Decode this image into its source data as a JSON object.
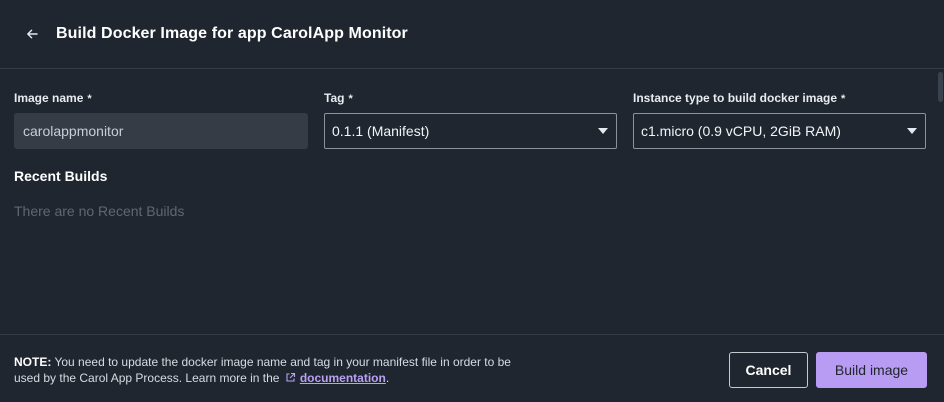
{
  "header": {
    "title": "Build Docker Image for app CarolApp Monitor",
    "back_icon": "arrow-left-icon"
  },
  "form": {
    "image_name": {
      "label": "Image name",
      "required_mark": "*",
      "value": "carolappmonitor"
    },
    "tag": {
      "label": "Tag",
      "required_mark": "*",
      "selected": "0.1.1 (Manifest)"
    },
    "instance_type": {
      "label": "Instance type to build docker image",
      "required_mark": "*",
      "selected": "c1.micro (0.9 vCPU, 2GiB RAM)"
    }
  },
  "recent_builds": {
    "title": "Recent Builds",
    "empty_text": "There are no Recent Builds"
  },
  "footer": {
    "note_label": "NOTE:",
    "note_text": " You need to update the docker image name and tag in your manifest file in order to be used by the Carol App Process. Learn more in the",
    "link_text": "documentation",
    "note_end": ".",
    "cancel_label": "Cancel",
    "build_label": "Build image"
  },
  "colors": {
    "background": "#1f2630",
    "accent": "#b89bf2",
    "link": "#b9a2f3"
  }
}
